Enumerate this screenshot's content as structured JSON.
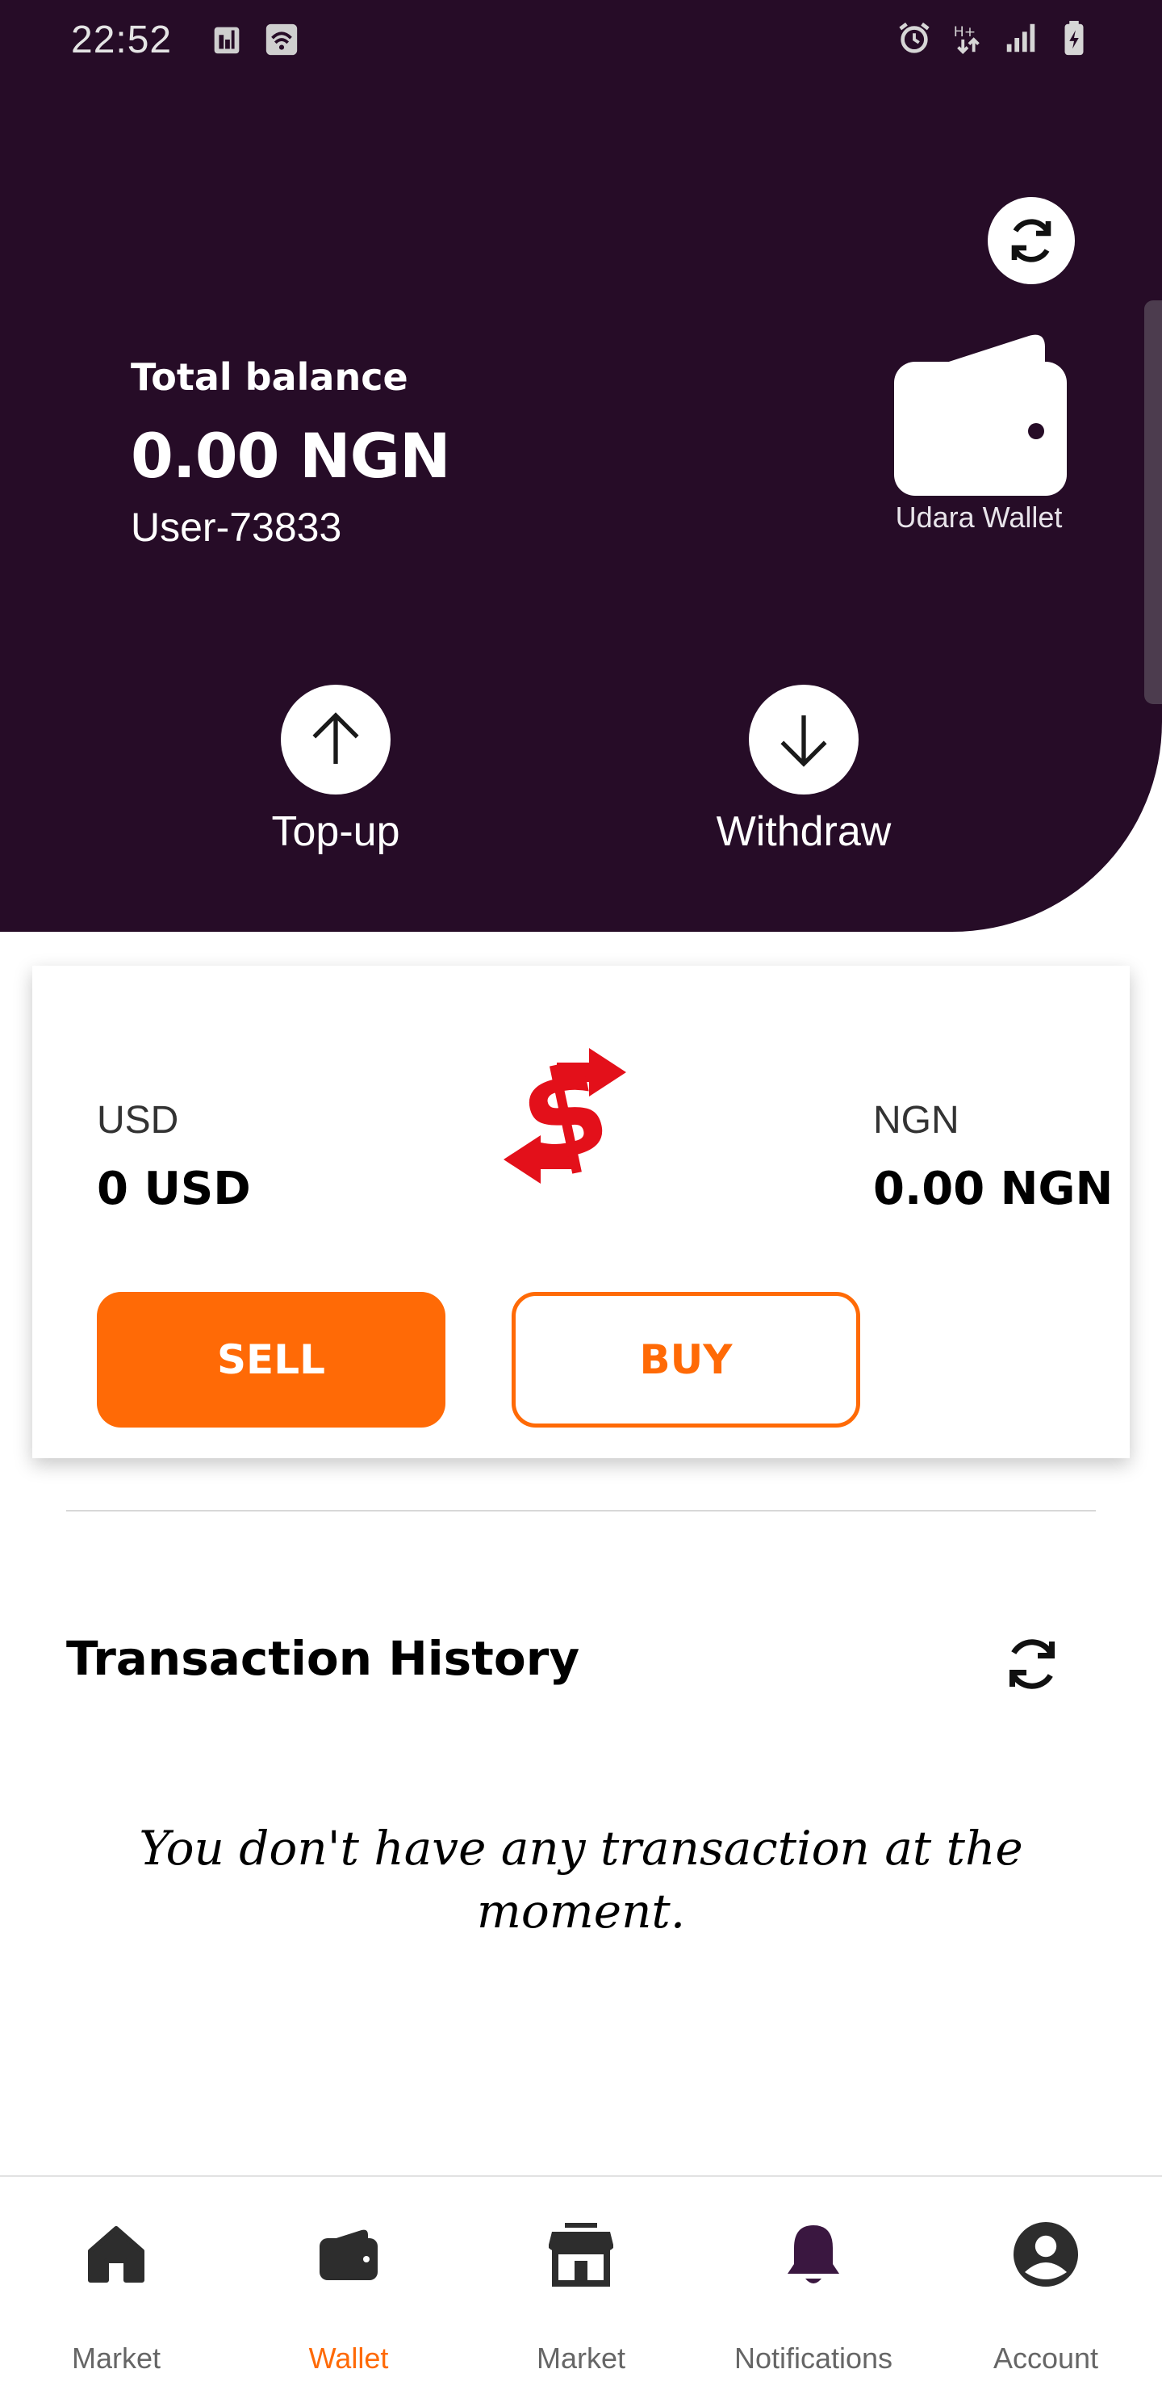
{
  "status_bar": {
    "time": "22:52",
    "left_icons": [
      "sim-icon",
      "wifi-icon"
    ],
    "right_icons": [
      "alarm-icon",
      "data-arrows-icon",
      "signal-icon",
      "battery-icon"
    ]
  },
  "header": {
    "balance_label": "Total balance",
    "balance_amount": "0.00 NGN",
    "user_id": "User-73833",
    "logo_text": "Udara Wallet",
    "refresh_icon": "refresh-icon"
  },
  "actions": {
    "topup_label": "Top-up",
    "withdraw_label": "Withdraw"
  },
  "exchange": {
    "left_currency": "USD",
    "left_value": "0 USD",
    "right_currency": "NGN",
    "right_value": "0.00 NGN",
    "sell_label": "SELL",
    "buy_label": "BUY"
  },
  "history": {
    "title": "Transaction History",
    "empty_message": "You don't have any transaction at the moment."
  },
  "bottom_nav": {
    "items": [
      {
        "label": "Market",
        "icon": "home-icon"
      },
      {
        "label": "Wallet",
        "icon": "wallet-icon"
      },
      {
        "label": "Market",
        "icon": "store-icon"
      },
      {
        "label": "Notifications",
        "icon": "bell-icon"
      },
      {
        "label": "Account",
        "icon": "account-icon"
      }
    ],
    "active_index": 1
  },
  "colors": {
    "header_bg": "#260c27",
    "accent": "#ff6a06",
    "dollar_red": "#e3101a",
    "nav_icon": "#2d2d2d",
    "bell_icon": "#3a1740"
  }
}
